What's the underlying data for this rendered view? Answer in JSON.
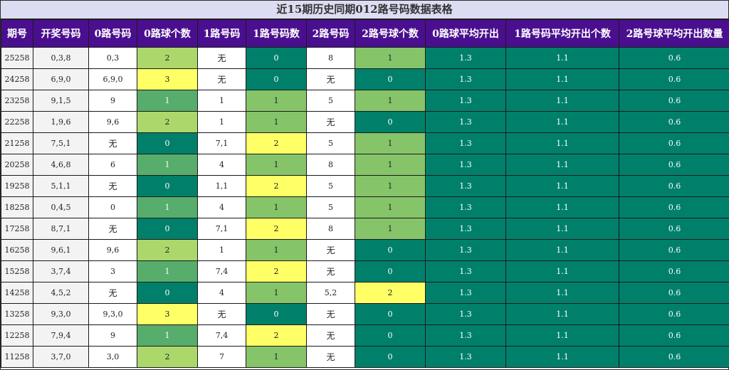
{
  "title": "近15期历史同期012路号码数据表格",
  "headers": [
    "期号",
    "开奖号码",
    "0路号码",
    "0路球个数",
    "1路号码",
    "1路号码数",
    "2路号码",
    "2路号球个数",
    "0路球平均开出",
    "1路号码平均开出个数",
    "2路号球平均开出数量"
  ],
  "rows": [
    [
      "25258",
      "0,3,8",
      "0,3",
      "2",
      "无",
      "0",
      "8",
      "1",
      "1.3",
      "1.1",
      "0.6"
    ],
    [
      "24258",
      "6,9,0",
      "6,9,0",
      "3",
      "无",
      "0",
      "无",
      "0",
      "1.3",
      "1.1",
      "0.6"
    ],
    [
      "23258",
      "9,1,5",
      "9",
      "1",
      "1",
      "1",
      "5",
      "1",
      "1.3",
      "1.1",
      "0.6"
    ],
    [
      "22258",
      "1,9,6",
      "9,6",
      "2",
      "1",
      "1",
      "无",
      "0",
      "1.3",
      "1.1",
      "0.6"
    ],
    [
      "21258",
      "7,5,1",
      "无",
      "0",
      "7,1",
      "2",
      "5",
      "1",
      "1.3",
      "1.1",
      "0.6"
    ],
    [
      "20258",
      "4,6,8",
      "6",
      "1",
      "4",
      "1",
      "8",
      "1",
      "1.3",
      "1.1",
      "0.6"
    ],
    [
      "19258",
      "5,1,1",
      "无",
      "0",
      "1,1",
      "2",
      "5",
      "1",
      "1.3",
      "1.1",
      "0.6"
    ],
    [
      "18258",
      "0,4,5",
      "0",
      "1",
      "4",
      "1",
      "5",
      "1",
      "1.3",
      "1.1",
      "0.6"
    ],
    [
      "17258",
      "8,7,1",
      "无",
      "0",
      "7,1",
      "2",
      "8",
      "1",
      "1.3",
      "1.1",
      "0.6"
    ],
    [
      "16258",
      "9,6,1",
      "9,6",
      "2",
      "1",
      "1",
      "无",
      "0",
      "1.3",
      "1.1",
      "0.6"
    ],
    [
      "15258",
      "3,7,4",
      "3",
      "1",
      "7,4",
      "2",
      "无",
      "0",
      "1.3",
      "1.1",
      "0.6"
    ],
    [
      "14258",
      "4,5,2",
      "无",
      "0",
      "4",
      "1",
      "5,2",
      "2",
      "1.3",
      "1.1",
      "0.6"
    ],
    [
      "13258",
      "9,3,0",
      "9,3,0",
      "3",
      "无",
      "0",
      "无",
      "0",
      "1.3",
      "1.1",
      "0.6"
    ],
    [
      "12258",
      "7,9,4",
      "9",
      "1",
      "7,4",
      "2",
      "无",
      "0",
      "1.3",
      "1.1",
      "0.6"
    ],
    [
      "11258",
      "3,7,0",
      "3,0",
      "2",
      "7",
      "1",
      "无",
      "0",
      "1.3",
      "1.1",
      "0.6"
    ]
  ],
  "colors": {
    "header_bg": "#4a0f8f",
    "title_bg": "#dcdcf2",
    "count_0": "#00806a",
    "count_1": "#57ad6b",
    "count_1_alt": "#86c46a",
    "count_2": "#acd86b",
    "count_3": "#ffff66",
    "average_bg": "#00806a"
  }
}
